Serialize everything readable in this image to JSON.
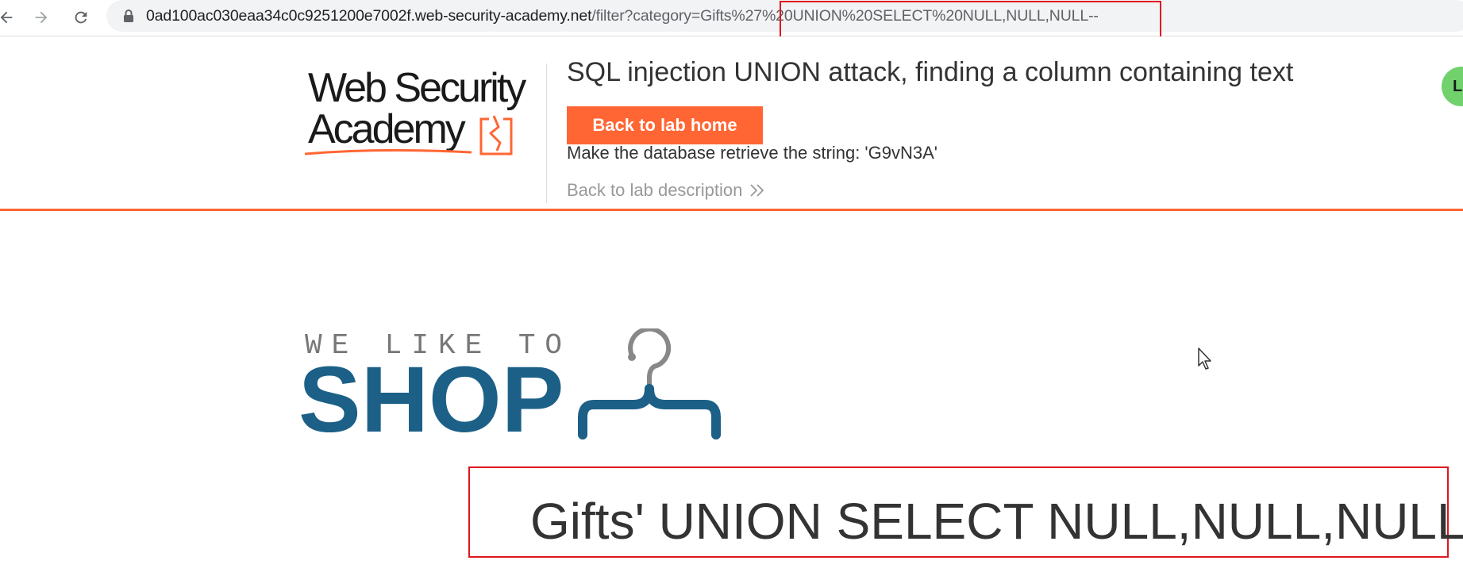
{
  "browser": {
    "url_host": "0ad100ac030eaa34c0c9251200e7002f.web-security-academy.net",
    "url_path": "/filter?category=Gifts%27%20UNION%20SELECT%20NULL,NULL,NULL--"
  },
  "lab_header": {
    "logo_line1": "Web Security",
    "logo_line2": "Academy",
    "title": "SQL injection UNION attack, finding a column containing text",
    "home_button_label": "Back to lab home",
    "instruction": "Make the database retrieve the string: 'G9vN3A'",
    "description_link": "Back to lab description",
    "avatar_initial": "L"
  },
  "shop": {
    "tagline": "WE LIKE TO",
    "brand": "SHOP"
  },
  "category": {
    "heading": "Gifts' UNION SELECT NULL,NULL,NULL--"
  },
  "colors": {
    "accent": "#ff6633",
    "shop_blue": "#1c6088",
    "highlight_red": "#e0161f"
  }
}
